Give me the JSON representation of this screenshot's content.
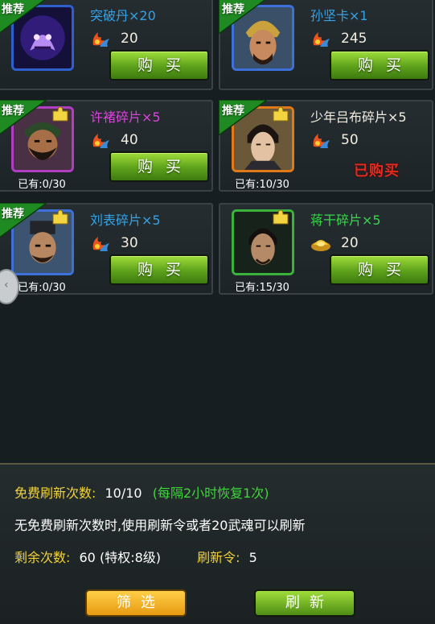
{
  "items": [
    {
      "name": "突破丹×20",
      "name_color": "#34a2e6",
      "currency": "soul",
      "price": "20",
      "owned": "",
      "recommend": true,
      "puzzle": false,
      "status": "buy",
      "frame": "#2f5fcc",
      "bg": "#1b1446",
      "portrait": "demon-mask"
    },
    {
      "name": "孙坚卡×1",
      "name_color": "#34a2e6",
      "currency": "soul",
      "price": "245",
      "owned": "",
      "recommend": true,
      "puzzle": false,
      "status": "buy",
      "frame": "#3d70d8",
      "bg": "#31445a",
      "portrait": "general-helmet"
    },
    {
      "name": "许褚碎片×5",
      "name_color": "#e040e0",
      "currency": "soul",
      "price": "40",
      "owned": "已有:0/30",
      "recommend": true,
      "puzzle": true,
      "status": "buy",
      "frame": "#b03ec0",
      "bg": "#4a2a40",
      "portrait": "general-beard"
    },
    {
      "name": "少年吕布碎片×5",
      "name_color": "#f0ece0",
      "currency": "soul",
      "price": "50",
      "owned": "已有:10/30",
      "recommend": true,
      "puzzle": true,
      "status": "bought",
      "frame": "#e07a18",
      "bg": "#5a4a30",
      "portrait": "young-warrior"
    },
    {
      "name": "刘表碎片×5",
      "name_color": "#34a2e6",
      "currency": "soul",
      "price": "30",
      "owned": "已有:0/30",
      "recommend": true,
      "puzzle": true,
      "status": "buy",
      "frame": "#3d70d8",
      "bg": "#39506a",
      "portrait": "scholar-official"
    },
    {
      "name": "蒋干碎片×5",
      "name_color": "#36d84a",
      "currency": "gold",
      "price": "20",
      "owned": "已有:15/30",
      "recommend": false,
      "puzzle": true,
      "status": "buy",
      "frame": "#3bb23c",
      "bg": "#1d2a1c",
      "portrait": "advisor"
    }
  ],
  "labels": {
    "recommend": "推荐",
    "buy": "购买",
    "bought": "已购买"
  },
  "panel": {
    "free_label": "免费刷新次数:",
    "free_value": "10/10",
    "free_note": "(每隔2小时恢复1次)",
    "info": "无免费刷新次数时,使用刷新令或者20武魂可以刷新",
    "remain_label": "剩余次数:",
    "remain_value": "60 (特权:8级)",
    "token_label": "刷新令:",
    "token_value": "5"
  },
  "buttons": {
    "filter": "筛选",
    "refresh": "刷新"
  },
  "colors": {
    "label_yellow": "#f2d33a",
    "value_white": "#ffffff",
    "note_green": "#3ed63a",
    "buy_green": "#5da11b",
    "sold_red": "#e02b20"
  }
}
